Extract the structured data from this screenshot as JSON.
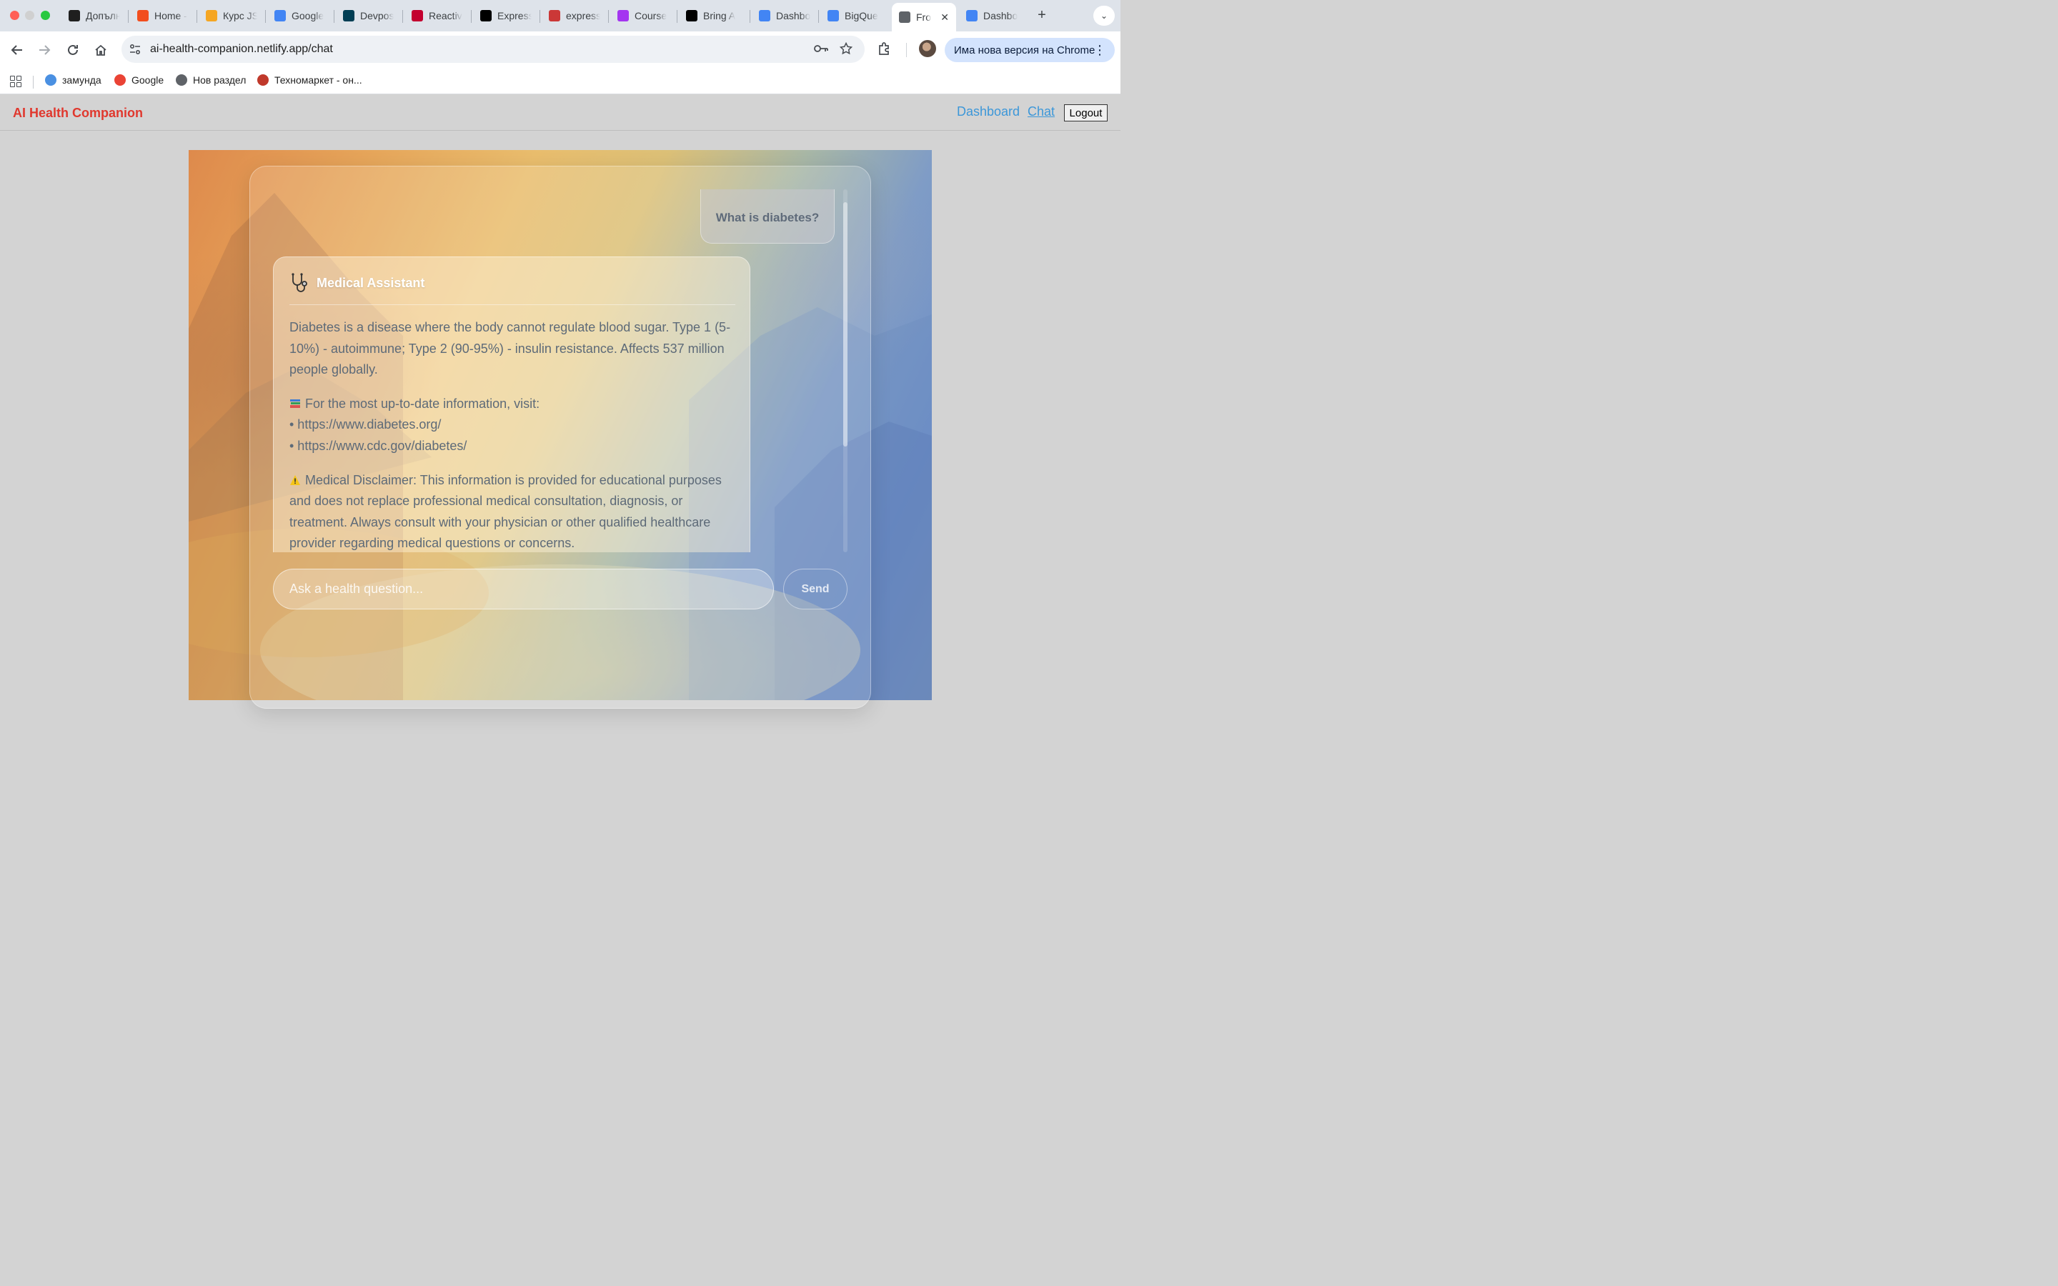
{
  "browser": {
    "tabs": [
      {
        "title": "Допълн",
        "icon": "chatgpt-icon",
        "color": "#1f1f1f"
      },
      {
        "title": "Home -",
        "icon": "figma-icon",
        "color": "#f24e1e"
      },
      {
        "title": "Курс JS",
        "icon": "course-icon",
        "color": "#f5a623"
      },
      {
        "title": "Google",
        "icon": "google-translate-icon",
        "color": "#4285f4"
      },
      {
        "title": "Devpos",
        "icon": "devpost-icon",
        "color": "#003e54"
      },
      {
        "title": "Reactiv",
        "icon": "angular-icon",
        "color": "#c3002f"
      },
      {
        "title": "Express",
        "icon": "express-icon",
        "color": "#000000"
      },
      {
        "title": "express",
        "icon": "npm-icon",
        "color": "#cb3837"
      },
      {
        "title": "Course",
        "icon": "udemy-icon",
        "color": "#a435f0"
      },
      {
        "title": "Bring A",
        "icon": "bring-icon",
        "color": "#000000"
      },
      {
        "title": "Dashbo",
        "icon": "looker-icon",
        "color": "#4285f4"
      },
      {
        "title": "BigQue",
        "icon": "looker-icon",
        "color": "#4285f4"
      },
      {
        "title": "Fro",
        "icon": "globe-icon",
        "color": "#5f6368",
        "active": true
      },
      {
        "title": "Dashbo",
        "icon": "looker-icon",
        "color": "#4285f4"
      }
    ],
    "url": "ai-health-companion.netlify.app/chat",
    "update_label": "Има нова версия на Chrome",
    "bookmarks": [
      {
        "label": "замунда",
        "icon": "zamunda-icon",
        "color": "#4a90e2"
      },
      {
        "label": "Google",
        "icon": "google-icon",
        "color": "#ea4335"
      },
      {
        "label": "Нов раздел",
        "icon": "globe-icon",
        "color": "#5f6368"
      },
      {
        "label": "Техномаркет - он...",
        "icon": "technomarket-icon",
        "color": "#c0392b"
      }
    ]
  },
  "app": {
    "brand": "AI Health Companion",
    "brand_color": "#e0382e",
    "nav": {
      "dashboard": "Dashboard",
      "chat": "Chat",
      "logout": "Logout"
    },
    "link_color": "#3c97d9"
  },
  "chat": {
    "user_message": "What is diabetes?",
    "assistant": {
      "name": "Medical Assistant",
      "icon": "stethoscope-icon",
      "answer": "Diabetes is a disease where the body cannot regulate blood sugar. Type 1 (5-10%) - autoimmune; Type 2 (90-95%) - insulin resistance. Affects 537 million people globally.",
      "resources_intro": "For the most up-to-date information, visit:",
      "resources_icon": "books-icon",
      "links": [
        "• https://www.diabetes.org/",
        "• https://www.cdc.gov/diabetes/"
      ],
      "disclaimer_icon": "warning-icon",
      "disclaimer": "Medical Disclaimer: This information is provided for educational purposes and does not replace professional medical consultation, diagnosis, or treatment. Always consult with your physician or other qualified healthcare provider regarding medical questions or concerns."
    },
    "input_placeholder": "Ask a health question...",
    "send_label": "Send"
  }
}
